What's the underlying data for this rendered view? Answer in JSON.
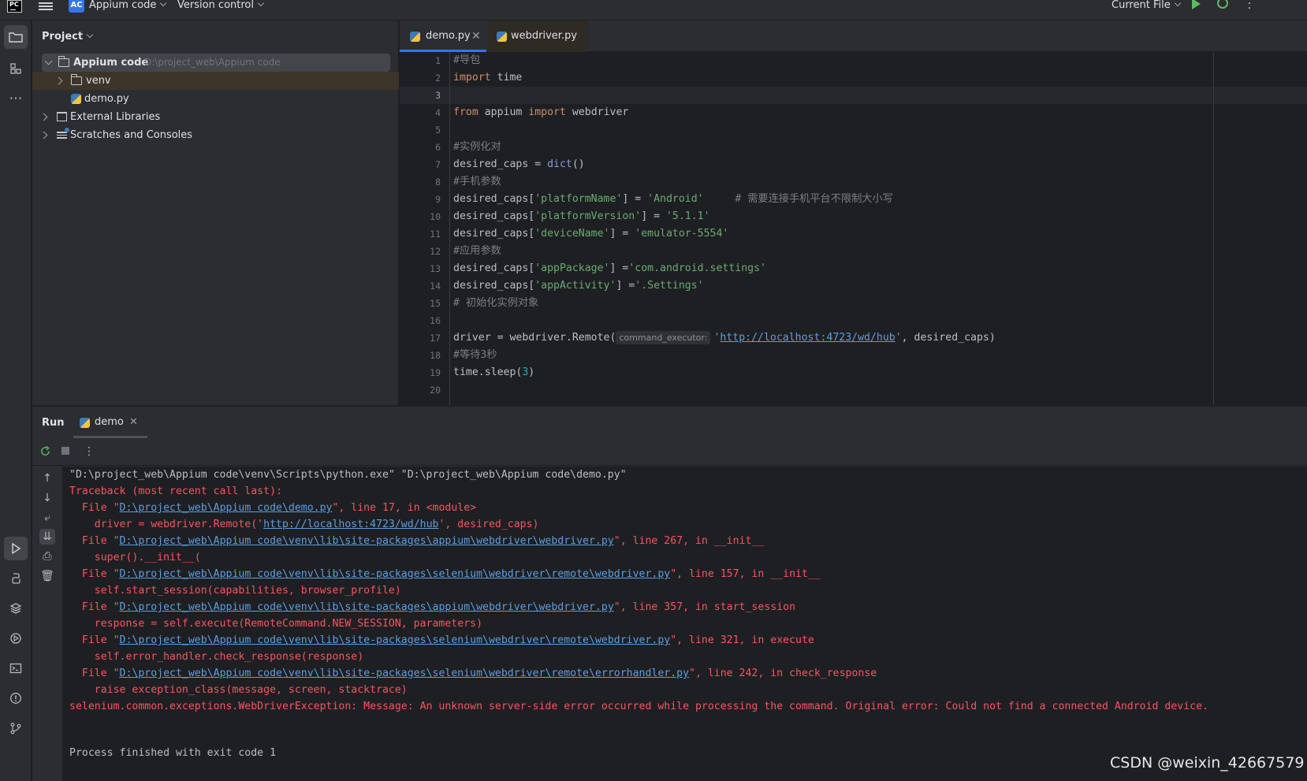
{
  "topbar": {
    "project_badge": "AC",
    "project_name": "Appium code",
    "version_control": "Version control",
    "run_config": "Current File"
  },
  "project_panel": {
    "title": "Project",
    "tree": [
      {
        "label": "Appium code",
        "hint": "D:\\project_web\\Appium code"
      },
      {
        "label": "venv"
      },
      {
        "label": "demo.py"
      },
      {
        "label": "External Libraries"
      },
      {
        "label": "Scratches and Consoles"
      }
    ]
  },
  "editor": {
    "tabs": [
      {
        "label": "demo.py",
        "active": true
      },
      {
        "label": "webdriver.py",
        "active": false
      }
    ],
    "current_line": 3,
    "code_lines": [
      "#导包",
      "import time",
      "",
      "from appium import webdriver",
      "",
      "#实例化对",
      "desired_caps = dict()",
      "#手机参数",
      "desired_caps['platformName'] = 'Android'     # 需要连接手机平台不限制大小写",
      "desired_caps['platformVersion'] = '5.1.1'",
      "desired_caps['deviceName'] = 'emulator-5554'",
      "#应用参数",
      "desired_caps['appPackage'] ='com.android.settings'",
      "desired_caps['appActivity'] ='.Settings'",
      "# 初始化实例对象",
      "",
      "driver = webdriver.Remote( command_executor: 'http://localhost:4723/wd/hub', desired_caps)",
      "#等待3秒",
      "time.sleep(3)",
      ""
    ],
    "inlay_hint": "command_executor:"
  },
  "run_panel": {
    "title": "Run",
    "tab_label": "demo",
    "output": [
      "\"D:\\project_web\\Appium code\\venv\\Scripts\\python.exe\" \"D:\\project_web\\Appium code\\demo.py\"",
      "Traceback (most recent call last):",
      "  File \"D:\\project_web\\Appium code\\demo.py\", line 17, in <module>",
      "    driver = webdriver.Remote('http://localhost:4723/wd/hub', desired_caps)",
      "  File \"D:\\project_web\\Appium code\\venv\\lib\\site-packages\\appium\\webdriver\\webdriver.py\", line 267, in __init__",
      "    super().__init__(",
      "  File \"D:\\project_web\\Appium code\\venv\\lib\\site-packages\\selenium\\webdriver\\remote\\webdriver.py\", line 157, in __init__",
      "    self.start_session(capabilities, browser_profile)",
      "  File \"D:\\project_web\\Appium code\\venv\\lib\\site-packages\\appium\\webdriver\\webdriver.py\", line 357, in start_session",
      "    response = self.execute(RemoteCommand.NEW_SESSION, parameters)",
      "  File \"D:\\project_web\\Appium code\\venv\\lib\\site-packages\\selenium\\webdriver\\remote\\webdriver.py\", line 321, in execute",
      "    self.error_handler.check_response(response)",
      "  File \"D:\\project_web\\Appium code\\venv\\lib\\site-packages\\selenium\\webdriver\\remote\\errorhandler.py\", line 242, in check_response",
      "    raise exception_class(message, screen, stacktrace)",
      "selenium.common.exceptions.WebDriverException: Message: An unknown server-side error occurred while processing the command. Original error: Could not find a connected Android device.",
      "",
      "Process finished with exit code 1"
    ]
  },
  "watermark": "CSDN @weixin_42667579",
  "colors": {
    "accent": "#3574f0",
    "error_text": "#f75464",
    "link": "#5e9ee0",
    "run_green": "#5fb865"
  }
}
